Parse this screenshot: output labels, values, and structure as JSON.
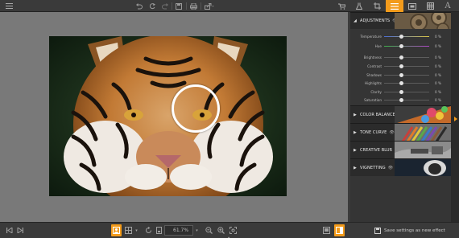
{
  "toolbar": {
    "menu_icon": "hamburger-menu-icon",
    "actions": [
      "undo-icon",
      "undo-all-icon",
      "redo-icon",
      "save-icon",
      "print-icon",
      "share-icon"
    ]
  },
  "right_tabs": [
    {
      "name": "cart",
      "icon": "cart-icon",
      "active": false
    },
    {
      "name": "flask",
      "icon": "flask-icon",
      "active": false
    },
    {
      "name": "crop",
      "icon": "crop-icon",
      "active": false
    },
    {
      "name": "adjust",
      "icon": "sliders-icon",
      "active": true
    },
    {
      "name": "frame",
      "icon": "frame-icon",
      "active": false
    },
    {
      "name": "texture",
      "icon": "grid-icon",
      "active": false
    },
    {
      "name": "text",
      "icon": "text-icon",
      "active": false,
      "glyph": "A"
    }
  ],
  "panel": {
    "adjustments": {
      "title": "ADJUSTMENTS",
      "sliders": [
        {
          "label": "Temperature",
          "value": "0 %"
        },
        {
          "label": "Hue",
          "value": "0 %"
        },
        {
          "label": "Brightness",
          "value": "0 %"
        },
        {
          "label": "Contrast",
          "value": "0 %"
        },
        {
          "label": "Shadows",
          "value": "0 %"
        },
        {
          "label": "Highlights",
          "value": "0 %"
        },
        {
          "label": "Clarity",
          "value": "0 %"
        },
        {
          "label": "Saturation",
          "value": "0 %"
        }
      ]
    },
    "sections": [
      {
        "title": "COLOR BALANCE"
      },
      {
        "title": "TONE CURVE"
      },
      {
        "title": "CREATIVE BLUR"
      },
      {
        "title": "VIGNETTING"
      }
    ]
  },
  "bottom": {
    "zoom_value": "61.7%",
    "save_effect_label": "Save settings as new effect"
  },
  "colors": {
    "accent": "#f39b1b",
    "canvas_bg": "#797979",
    "panel_bg": "#353535"
  }
}
